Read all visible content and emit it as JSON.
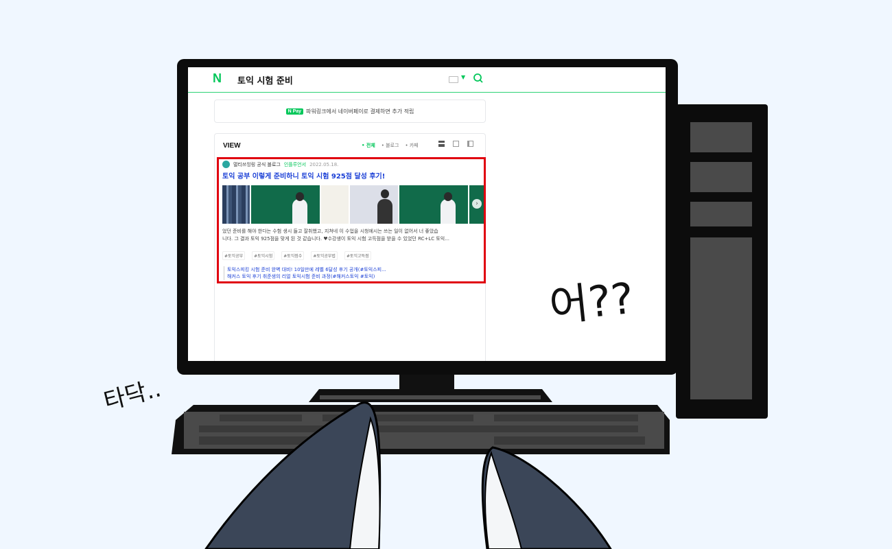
{
  "search": {
    "logo": "N",
    "query": "토익 시험 준비"
  },
  "ad": {
    "badge": "N Pay",
    "text": "파워링크에서 네이버페이로 결제하면 추가 적립"
  },
  "view": {
    "title": "VIEW",
    "filters": [
      "• 전체",
      "• 블로그",
      "• 카페"
    ],
    "card": {
      "blog_name": "멀티쓰잉링 공식 블로그",
      "influencer": "인플루언서",
      "date": "2022.05.18.",
      "title": "토익 공부 이렇게 준비하니 토익 시험 925점 달성 후기!",
      "snippet_line1": "었던 준비를 해야 한다는 수험 생시 들고 잘취했고, 지쳐네 이 수업을 시청에시는 쓰는 일이 없어서 너 좋았습",
      "snippet_line2": "니다. 그 결과 토익 925점을 맞게 된 것 같습니다. ♥수강생이 토익 시험 고득점을 받을 수 있었던 RC+LC 토익...",
      "tags": [
        "#토익공부",
        "#토익시험",
        "#토익점수",
        "#토익공부법",
        "#토익고득점"
      ],
      "related": [
        "토익스피킹 시험 준비 완벽 대비! 10일만에 레벨 6달성 후기 공개(#토익스피...",
        "해커스 토익 후기 취준생의 리얼 토익시험 준비 과정(#해커스토익 #토익)"
      ]
    }
  },
  "illustration": {
    "exclaim": "어??",
    "typing_sound": "타닥.."
  },
  "colors": {
    "naver_green": "#03c75a",
    "highlight_red": "#e0000f",
    "link_blue": "#1a3fd6"
  }
}
